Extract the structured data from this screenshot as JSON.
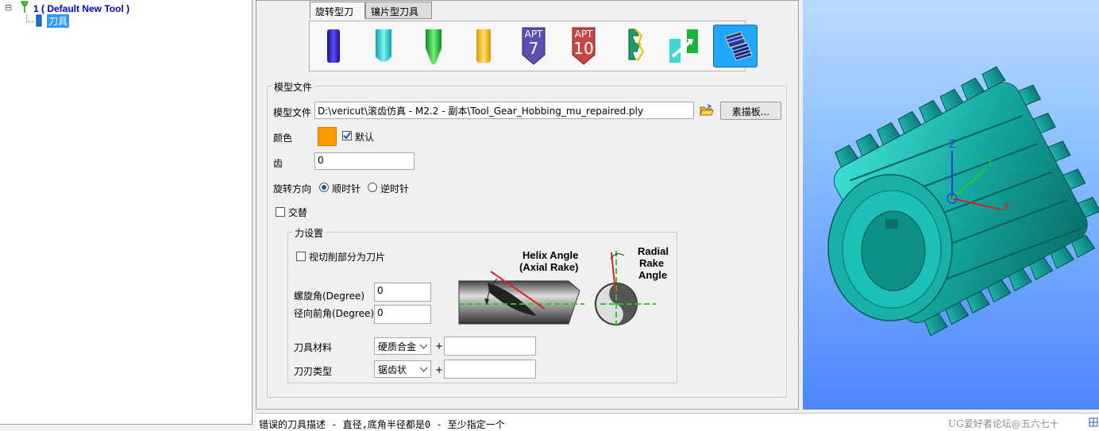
{
  "tree": {
    "expander": "⊟",
    "root_label": "1 ( Default New Tool )",
    "child_label": "刀具"
  },
  "tabs": [
    {
      "label": "旋转型刀具"
    },
    {
      "label": "镶片型刀具"
    }
  ],
  "toolbar": {
    "apt7_top": "APT",
    "apt7_num": "7",
    "apt10_top": "APT",
    "apt10_num": "10"
  },
  "model_group": {
    "legend": "模型文件",
    "file_label": "模型文件",
    "file_value": "D:\\vericut\\滚齿仿真 - M2.2 - 副本\\Tool_Gear_Hobbing_mu_repaired.ply",
    "sketch_button": "素描板...",
    "color_label": "颜色",
    "color_value": "#ff9900",
    "default_label": "默认",
    "teeth_label": "齿",
    "teeth_value": "0",
    "rotation_label": "旋转方向",
    "cw_label": "顺时针",
    "ccw_label": "逆时针",
    "alternate_label": "交替"
  },
  "force_group": {
    "legend": "力设置",
    "as_insert_label": "视切削部分为刀片",
    "helix_label": "螺旋角(Degree)",
    "helix_value": "0",
    "radial_label": "径向前角(Degree)",
    "radial_value": "0",
    "material_label": "刀具材料",
    "material_value": "硬质合金",
    "material_plus": "+",
    "edge_label": "刀刃类型",
    "edge_value": "锯齿状",
    "edge_plus": "+",
    "diagram": {
      "helix_line1": "Helix Angle",
      "helix_line2": "(Axial Rake)",
      "radial_line1": "Radial",
      "radial_line2": "Rake",
      "radial_line3": "Angle"
    }
  },
  "viewport": {
    "axis_x": "X",
    "axis_y": "Y",
    "axis_z": "Z"
  },
  "status": {
    "message": "错误的刀具描述 - 直径,底角半径都是0 - 至少指定一个",
    "watermark": "UG爱好者论坛@五六七十"
  }
}
